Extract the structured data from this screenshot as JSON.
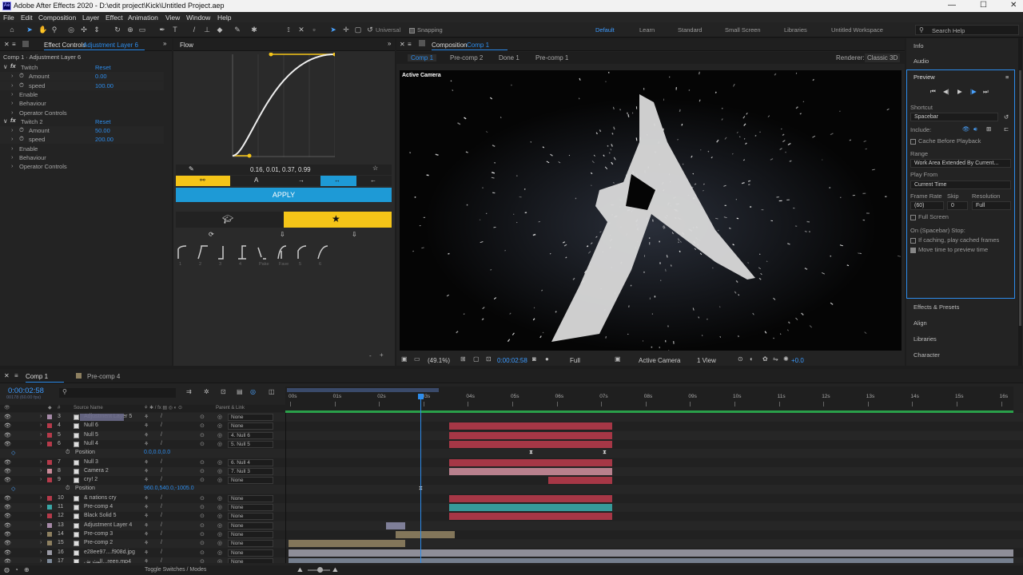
{
  "app": {
    "title": "Adobe After Effects 2020 - D:\\edit project\\Kick\\Untitled Project.aep",
    "icon": "Ae",
    "win_min": "—",
    "win_max": "☐",
    "win_close": "✕"
  },
  "menu": [
    "File",
    "Edit",
    "Composition",
    "Layer",
    "Effect",
    "Animation",
    "View",
    "Window",
    "Help"
  ],
  "toolbar": {
    "universal": "Universal",
    "snapping": "Snapping",
    "workspaces": [
      "Default",
      "Learn",
      "Standard",
      "Small Screen",
      "Libraries",
      "Untitled Workspace"
    ],
    "search": "Search Help"
  },
  "effect_controls": {
    "tab": "Effect Controls",
    "layer": "Adjustment Layer 6",
    "crumb": "Comp 1 · Adjustment Layer 6",
    "rows": [
      {
        "t": "fx",
        "name": "Twitch",
        "val": "Reset"
      },
      {
        "t": "p",
        "name": "Amount",
        "val": "0.00"
      },
      {
        "t": "p",
        "name": "speed",
        "val": "100.00"
      },
      {
        "t": "g",
        "name": "Enable",
        "val": ""
      },
      {
        "t": "g",
        "name": "Behaviour",
        "val": ""
      },
      {
        "t": "g",
        "name": "Operator Controls",
        "val": ""
      },
      {
        "t": "fx",
        "name": "Twitch 2",
        "val": "Reset"
      },
      {
        "t": "p",
        "name": "Amount",
        "val": "50.00"
      },
      {
        "t": "p",
        "name": "speed",
        "val": "200.00"
      },
      {
        "t": "g",
        "name": "Enable",
        "val": ""
      },
      {
        "t": "g",
        "name": "Behaviour",
        "val": ""
      },
      {
        "t": "g",
        "name": "Operator Controls",
        "val": ""
      }
    ]
  },
  "flow": {
    "tab": "Flow",
    "bezier": "0.16, 0.01, 0.37, 0.99",
    "apply": "APPLY",
    "presets": [
      "1",
      "2",
      "3",
      "4",
      "Pake",
      "Fave",
      "5",
      "6"
    ],
    "zoom_minus": "-",
    "zoom_plus": "+"
  },
  "composition": {
    "tab": "Composition",
    "comp_name": "Comp 1",
    "crumbs": [
      "Comp 1",
      "Pre-comp 2",
      "Done 1",
      "Pre-comp 1"
    ],
    "renderer_label": "Renderer:",
    "renderer": "Classic 3D",
    "camera_label": "Active Camera",
    "letter": "A",
    "footer": {
      "zoom": "(49.1%)",
      "time": "0:00:02:58",
      "quality": "Full",
      "camera": "Active Camera",
      "view": "1 View",
      "exposure": "+0.0"
    }
  },
  "right": {
    "info": "Info",
    "audio": "Audio",
    "preview": "Preview",
    "shortcut_label": "Shortcut",
    "shortcut": "Spacebar",
    "include_label": "Include:",
    "cache": "Cache Before Playback",
    "range_label": "Range",
    "range": "Work Area Extended By Current...",
    "playfrom_label": "Play From",
    "playfrom": "Current Time",
    "fr_label": "Frame Rate",
    "skip_label": "Skip",
    "res_label": "Resolution",
    "fr": "(60)",
    "skip": "0",
    "res": "Full",
    "fullscreen": "Full Screen",
    "stop_label": "On (Spacebar) Stop:",
    "if_caching": "If caching, play cached frames",
    "move_time": "Move time to preview time",
    "effects": "Effects & Presets",
    "align": "Align",
    "libraries": "Libraries",
    "character": "Character"
  },
  "timeline": {
    "tab1": "Comp 1",
    "tab2": "Pre-comp 4",
    "timecode": "0:00:02:58",
    "fps": "00178 (60.00 fps)",
    "col_num": "#",
    "col_source": "Source Name",
    "col_parent": "Parent & Link",
    "toggle": "Toggle Switches / Modes",
    "ruler": [
      "00s",
      "01s",
      "02s",
      "03s",
      "04s",
      "05s",
      "06s",
      "07s",
      "08s",
      "09s",
      "10s",
      "11s",
      "12s",
      "13s",
      "14s",
      "15s",
      "16s"
    ],
    "layers": [
      {
        "num": "3",
        "name": "Adjustment Layer 5",
        "parent": "None",
        "color": "#a68aa8"
      },
      {
        "num": "4",
        "name": "Null 6",
        "parent": "None",
        "color": "#b53a4a"
      },
      {
        "num": "5",
        "name": "Null 5",
        "parent": "4. Null 6",
        "color": "#b53a4a"
      },
      {
        "num": "6",
        "name": "Null 4",
        "parent": "5. Null 5",
        "color": "#b53a4a"
      },
      {
        "num": "",
        "name": "Position",
        "parent": "",
        "val": "0.0,0.0,0.0",
        "color": ""
      },
      {
        "num": "7",
        "name": "Null 3",
        "parent": "6. Null 4",
        "color": "#b53a4a"
      },
      {
        "num": "8",
        "name": "Camera 2",
        "parent": "7. Null 3",
        "color": "#c98b99"
      },
      {
        "num": "9",
        "name": "cry! 2",
        "parent": "None",
        "color": "#b53a4a"
      },
      {
        "num": "",
        "name": "Position",
        "parent": "",
        "val": "960.0,540.0,-1005.0",
        "color": ""
      },
      {
        "num": "10",
        "name": "& nations cry",
        "parent": "None",
        "color": "#b53a4a"
      },
      {
        "num": "11",
        "name": "Pre-comp 4",
        "parent": "None",
        "color": "#3aa6a6"
      },
      {
        "num": "12",
        "name": "Black Solid 5",
        "parent": "None",
        "color": "#b53a4a"
      },
      {
        "num": "13",
        "name": "Adjustment Layer 4",
        "parent": "None",
        "color": "#a68aa8"
      },
      {
        "num": "14",
        "name": "Pre-comp 3",
        "parent": "None",
        "color": "#8e8060"
      },
      {
        "num": "15",
        "name": "Pre-comp 2",
        "parent": "None",
        "color": "#8e8060"
      },
      {
        "num": "16",
        "name": "e28ee97....f908d.jpg",
        "parent": "None",
        "color": "#9a9aa5"
      },
      {
        "num": "17",
        "name": "البث ش...reen.mp4",
        "parent": "None",
        "color": "#7e8a9a"
      }
    ]
  }
}
